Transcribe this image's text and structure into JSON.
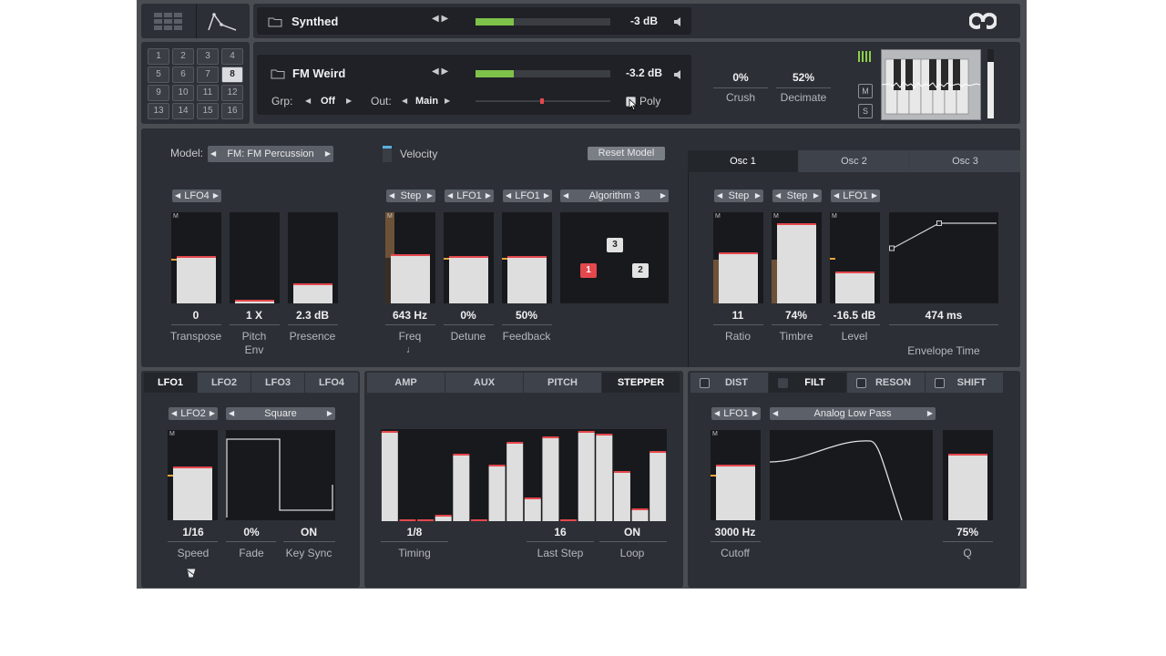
{
  "header": {
    "preset_name": "Synthed",
    "level": "-3 dB"
  },
  "pads": [
    "1",
    "2",
    "3",
    "4",
    "5",
    "6",
    "7",
    "8",
    "9",
    "10",
    "11",
    "12",
    "13",
    "14",
    "15",
    "16"
  ],
  "selected_pad": "8",
  "instrument": {
    "name": "FM Weird",
    "level": "-3.2 dB",
    "grp_label": "Grp:",
    "grp_value": "Off",
    "out_label": "Out:",
    "out_value": "Main",
    "poly_label": "Poly",
    "crush_value": "0%",
    "crush_label": "Crush",
    "decimate_value": "52%",
    "decimate_label": "Decimate",
    "m_label": "M",
    "s_label": "S"
  },
  "model": {
    "label": "Model:",
    "value": "FM: FM Percussion",
    "velocity_label": "Velocity",
    "reset_label": "Reset Model"
  },
  "global": {
    "mod_source": "LFO4",
    "m_badge": "M",
    "transpose": {
      "value": "0",
      "label": "Transpose",
      "level": 0.5
    },
    "pitch_env": {
      "value": "1 X",
      "label": "Pitch Env",
      "level": 0.02
    },
    "presence": {
      "value": "2.3 dB",
      "label": "Presence",
      "level": 0.2
    }
  },
  "fm": {
    "freq": {
      "mod": "Step",
      "value": "643 Hz",
      "label": "Freq",
      "level": 0.52
    },
    "detune": {
      "mod": "LFO1",
      "value": "0%",
      "label": "Detune",
      "level": 0.5
    },
    "feedback": {
      "mod": "LFO1",
      "value": "50%",
      "label": "Feedback",
      "level": 0.5
    },
    "algorithm": "Algorithm 3",
    "ops": [
      "1",
      "2",
      "3"
    ]
  },
  "osc_tabs": [
    "Osc 1",
    "Osc 2",
    "Osc 3"
  ],
  "osc": {
    "ratio": {
      "mod": "Step",
      "value": "11",
      "label": "Ratio",
      "level": 0.54
    },
    "timbre": {
      "mod": "Step",
      "value": "74%",
      "label": "Timbre",
      "level": 0.86
    },
    "level": {
      "mod": "LFO1",
      "value": "-16.5 dB",
      "label": "Level",
      "level": 0.33
    },
    "envelope_time": {
      "value": "474 ms",
      "label": "Envelope Time"
    }
  },
  "lfo_tabs": [
    "LFO1",
    "LFO2",
    "LFO3",
    "LFO4"
  ],
  "lfo": {
    "mod_source": "LFO2",
    "shape": "Square",
    "speed": {
      "value": "1/16",
      "label": "Speed",
      "level": 0.58
    },
    "fade": {
      "value": "0%",
      "label": "Fade"
    },
    "key_sync": {
      "value": "ON",
      "label": "Key Sync"
    }
  },
  "seq_tabs": [
    "AMP",
    "AUX",
    "PITCH",
    "STEPPER"
  ],
  "stepper": {
    "steps": [
      1.0,
      0.0,
      0.0,
      0.05,
      0.74,
      0.0,
      0.62,
      0.88,
      0.25,
      0.94,
      0.0,
      1.0,
      0.97,
      0.55,
      0.12,
      0.77
    ],
    "timing": {
      "value": "1/8",
      "label": "Timing"
    },
    "last_step": {
      "value": "16",
      "label": "Last Step"
    },
    "loop": {
      "value": "ON",
      "label": "Loop"
    }
  },
  "fx_tabs": [
    "DIST",
    "FILT",
    "RESON",
    "SHIFT"
  ],
  "filter": {
    "mod_source": "LFO1",
    "type": "Analog Low Pass",
    "cutoff": {
      "value": "3000 Hz",
      "label": "Cutoff",
      "level": 0.6
    },
    "q": {
      "value": "75%",
      "label": "Q",
      "level": 0.72
    }
  },
  "colors": {
    "background": "#4a4d52",
    "panel": "#2c2f35",
    "slider_fill": "#dedede",
    "slider_cap": "#e4484d",
    "meter_green": "#7fc24a",
    "op_active": "#e4484d"
  }
}
